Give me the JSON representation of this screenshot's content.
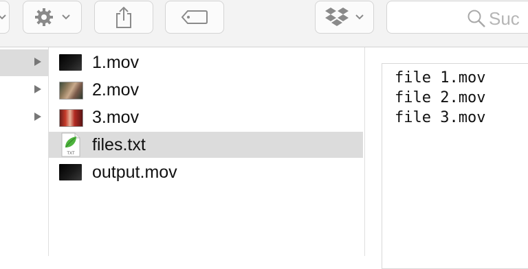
{
  "toolbar": {
    "buttons": [
      {
        "name": "view-options",
        "icon": "chevron-down-icon"
      },
      {
        "name": "action",
        "icon": "gear-icon"
      },
      {
        "name": "share",
        "icon": "share-icon"
      },
      {
        "name": "tags",
        "icon": "tag-icon"
      },
      {
        "name": "dropbox",
        "icon": "dropbox-icon"
      }
    ],
    "search": {
      "placeholder": "Suc",
      "icon": "search-icon"
    }
  },
  "files": [
    {
      "name": "1.mov",
      "thumbnail": "black-video",
      "has_disclosure": true,
      "selected": false
    },
    {
      "name": "2.mov",
      "thumbnail": "video-frame",
      "has_disclosure": true,
      "selected": false
    },
    {
      "name": "3.mov",
      "thumbnail": "video-frame",
      "has_disclosure": true,
      "selected": false
    },
    {
      "name": "files.txt",
      "thumbnail": "txt-document",
      "has_disclosure": false,
      "selected": true
    },
    {
      "name": "output.mov",
      "thumbnail": "black-video",
      "has_disclosure": false,
      "selected": false
    }
  ],
  "preview": {
    "lines": [
      "file 1.mov",
      "file 2.mov",
      "file 3.mov"
    ]
  },
  "colors": {
    "toolbar_bg": "#f3f3f3",
    "selection": "#dcdcdc",
    "icon_gray": "#7d7d7d"
  }
}
